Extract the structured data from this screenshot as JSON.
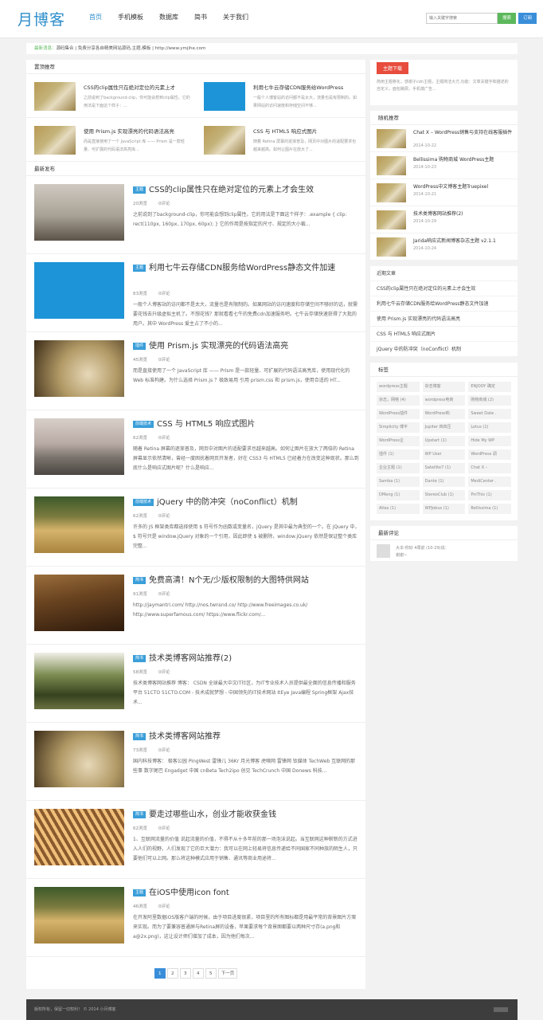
{
  "logo": "月博客",
  "nav": [
    "首页",
    "手机模板",
    "数据库",
    "简书",
    "关于我们"
  ],
  "search": {
    "placeholder": "输入关键字搜索",
    "btn": "搜索",
    "sub": "订阅"
  },
  "notice": {
    "label": "最新消息：",
    "text": "源码集合 | 免费分享各自精美网站源码,主题,模板 | http://www.ymjihe.com"
  },
  "sticky": {
    "title": "置顶推荐",
    "items": [
      {
        "t": "CSS的clip属性只在绝对定位的元素上才",
        "d": "之前说到了background-clip，你可能会想到clip属性。它的用法是下面这个样子：..."
      },
      {
        "t": "利用七牛云存储CDN服务给WordPress",
        "d": "一般个人博客站的访问都不是太大，流量也是有限制的。如果网站的访问速度和存储空间不够..."
      },
      {
        "t": "使用 Prism.js 实现漂亮的代码语法高亮",
        "d": "而是直接使用了一个 JavaScript 库 —— Prism 是一款轻量、可扩展的代码语法高亮库..."
      },
      {
        "t": "CSS 与 HTML5 响应式图片",
        "d": "随着 Retina 屏幕的逐渐普及，网页中对图片的适配要求也越来越高。如何让图片在放大了..."
      }
    ]
  },
  "latest": "最新发布",
  "posts": [
    {
      "cat": "主题",
      "title": "CSS的clip属性只在绝对定位的元素上才会生效",
      "views": "20浏览",
      "comments": "0评论",
      "ex": "之前说到了background-clip，你可能会想到clip属性。它的用法是下面这个样子：.example { clip: rect(110px, 160px, 170px, 60px); } 它的作用是按指定的尺寸、规定的大小裁..."
    },
    {
      "cat": "主题",
      "title": "利用七牛云存储CDN服务给WordPress静态文件加速",
      "views": "83浏览",
      "comments": "0评论",
      "ex": "一般个人博客站的访问都不是太大，流量也是有限制的。如果网站的访问速度和存储空间不够好的话，就需要花钱去升级虚拟主机了。不想花钱？那就看看七牛的免费cdn加速服务吧。七牛云存储快速获得了大批的用户。其中 WordPress 爱主占了不小的..."
    },
    {
      "cat": "插件",
      "title": "使用 Prism.js 实现漂亮的代码语法高亮",
      "views": "45浏览",
      "comments": "0评论",
      "ex": "而是直接使用了一个 JavaScript 库 —— Prism 是一款轻量、可扩展的代码语法高亮库，使用现代化的 Web 标准构建。为什么选择 Prism.js ？极致易用 引用 prism.css 和 prism.js，使用合适的 HT..."
    },
    {
      "cat": "前端技术",
      "title": "CSS 与 HTML5 响应式图片",
      "views": "62浏览",
      "comments": "0评论",
      "ex": "随着 Retina 屏幕的逐渐普及，网页中对图片的适配要求也越来越高。如何让图片在放大了两倍的 Retina 屏幕显示依然清晰，曾经一度困扰着网页开发者，好在 CSS3 与 HTML5 已经着力在改变这种现状。那么到底什么是响应式图片呢？什么是响应..."
    },
    {
      "cat": "前端技术",
      "title": "jQuery 中的防冲突（noConflict）机制",
      "views": "62浏览",
      "comments": "0评论",
      "ex": "许多的 JS 框架类库都选择使用 $ 符号作为函数或变量名，jQuery 是其中最为典型的一个。在 jQuery 中，$ 符号只是 window.jQuery 对象的一个引用，因此即使 $ 被删除，window.jQuery 依然是保证整个类库完整..."
    },
    {
      "cat": "简书",
      "title": "免费高清！N个无/少版权限制的大图特供网站",
      "views": "91浏览",
      "comments": "0评论",
      "ex": "http://jaymantri.com/ http://nos.twnsnd.co/ http://www.freeimages.co.uk/ http://www.superfamous.com/ https://www.flickr.com/..."
    },
    {
      "cat": "简书",
      "title": "技术类博客网站推荐(2)",
      "views": "58浏览",
      "comments": "0评论",
      "ex": "技术类博客网站推荐 博客： CSDN 全球最大中文IT社区，为IT专业技术人员提供最全面的信息传播和服务平台 51CTO 51CTO.COM - 技术成就梦想 - 中国领先的IT技术网站 ItEye Java编程 Spring框架 Ajax技术..."
    },
    {
      "cat": "简书",
      "title": "技术类博客网站推荐",
      "views": "73浏览",
      "comments": "0评论",
      "ex": "国内科技博客： 极客公园 PingWest 雷锋儿 36Kr 月光博客 虎嗅网 雷锋网 钛媒体 TechWeb 互联网的那些事 数字尾巴 Engadget 中国 cnBeta Tech2ipo 创见 TechCrunch 中国 Donews 科技..."
    },
    {
      "cat": "简书",
      "title": "要走过哪些山水，创业才能收获金钱",
      "views": "62浏览",
      "comments": "0评论",
      "ex": "1、互联网流量的价值 说起流量的价值，不得不从十多年前的那一场泡沫说起。当互联网这种崭新的方式进入人们的视野，人们发现了它的巨大潜力：我可以在网上轻易将信息传递给不同国家不同种族的陌生人，只要他们可以上网。那么将这种模式应用于销售、通讯等商业用途将..."
    },
    {
      "cat": "主题",
      "title": "在iOS中使用icon font",
      "views": "46浏览",
      "comments": "0评论",
      "ex": "在开发阿里数据iOS版客户端的时候，由于项目进度很紧，项目里的所有图标都是用最平常的背景图片方案来实现。而为了要兼容普通屏与Retina屏的设备，苹果要求每个背景图都要以两种尺寸存(a.png和a@2x.png)，这让设计师们增加了成本，因为他们每次..."
    }
  ],
  "pager": [
    "1",
    "2",
    "3",
    "4",
    "5",
    "下一页"
  ],
  "side": {
    "promo": {
      "tag": "主题下载",
      "d": "简用主题移化，感谢子cdn主题，主题简洁大方,功能：文章关键字和描述的自定义，面包路屑，手机端广告..."
    },
    "random": {
      "title": "随机推荐",
      "items": [
        {
          "t": "Chat X – WordPress销售与支持在线客服插件",
          "dt": "2014-10-22"
        },
        {
          "t": "Bellissima 购物商城 WordPress主题",
          "dt": "2014-10-23"
        },
        {
          "t": "WordPress中文博客主题Truepixel",
          "dt": "2014-10-21"
        },
        {
          "t": "技术类博客网站推荐(2)",
          "dt": "2014-10-29"
        },
        {
          "t": "Jarida响应式新闻博客杂志主题 v2.1.1",
          "dt": "2014-10-24"
        }
      ]
    },
    "recent": {
      "title": "近期文章",
      "items": [
        "CSS的clip属性只在绝对定位的元素上才会生效",
        "利用七牛云存储CDN服务给WordPress静态文件加速",
        "使用 Prism.js 实现漂亮的代码语法高亮",
        "CSS 与 HTML5 响应式图片",
        "jQuery 中的防冲突（noConflict）机制"
      ]
    },
    "tags": {
      "title": "标签",
      "items": [
        "wordpress主题",
        "杂志博客",
        "ENJOOY 确定",
        "杂志，网络 (4)",
        "wordpress电商",
        "购物商城 (2)",
        "WordPress插件",
        "WordPress响",
        "Sweet Date .",
        "Simplicity 博平",
        "Jupiter 四四压",
        "Lotus (1)",
        "WordPress企",
        "Upstart (1)",
        "Hide My WP",
        "插件 (1)",
        "WP User",
        "WordPress 调",
        "企业主题 (1)",
        "Satellite7 (1)",
        "Chat X –",
        "Samba (1)",
        "Dante (1)",
        "MediCenter .",
        "DMeng (1)",
        "StereoClub (1)",
        "PinThis (1)",
        "Atlas (1)",
        "WPJobus (1)",
        "Bellissima (1)"
      ]
    },
    "comments": {
      "title": "最新评论",
      "user": "大伞-你好 4周前 (10-29)说：",
      "text": "谢谢~"
    }
  },
  "footer": "版权所有，保留一切权利！ © 2014 小月博客"
}
